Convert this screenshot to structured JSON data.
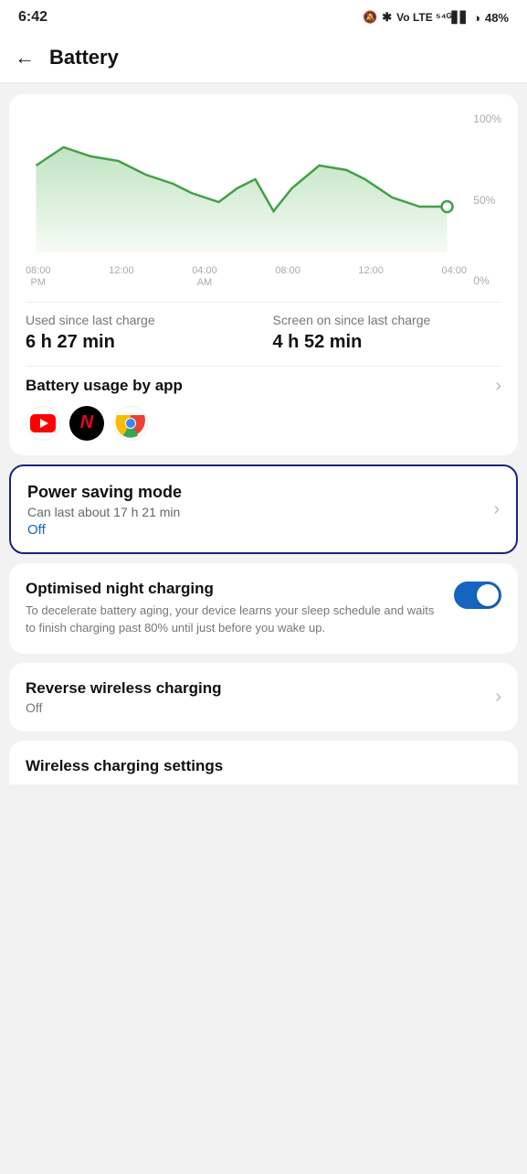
{
  "status_bar": {
    "time": "6:42",
    "battery_percent": "48%",
    "icons": "🔕 ⬥ ᵛᵒ ⁵⁴ᴳ"
  },
  "header": {
    "back_label": "←",
    "title": "Battery"
  },
  "chart": {
    "y_labels": [
      "100%",
      "50%",
      "0%"
    ],
    "x_labels": [
      {
        "line1": "08:00",
        "line2": "PM"
      },
      {
        "line1": "12:00",
        "line2": ""
      },
      {
        "line1": "04:00",
        "line2": "AM"
      },
      {
        "line1": "08:00",
        "line2": ""
      },
      {
        "line1": "12:00",
        "line2": ""
      },
      {
        "line1": "04:00",
        "line2": ""
      }
    ]
  },
  "usage_stats": {
    "used_since_label": "Used since last charge",
    "used_since_value": "6 h 27 min",
    "screen_on_label": "Screen on since last charge",
    "screen_on_value": "4 h 52 min"
  },
  "battery_usage_section": {
    "title": "Battery usage by app",
    "apps": [
      "YouTube",
      "Netflix",
      "Chrome"
    ]
  },
  "power_saving": {
    "title": "Power saving mode",
    "desc": "Can last about 17 h 21 min",
    "status": "Off"
  },
  "night_charging": {
    "title": "Optimised night charging",
    "desc": "To decelerate battery aging, your device learns your sleep schedule and waits to finish charging past 80% until just before you wake up.",
    "toggle_on": true
  },
  "reverse_wireless": {
    "title": "Reverse wireless charging",
    "status": "Off"
  },
  "wireless_settings": {
    "title": "Wireless charging settings"
  }
}
